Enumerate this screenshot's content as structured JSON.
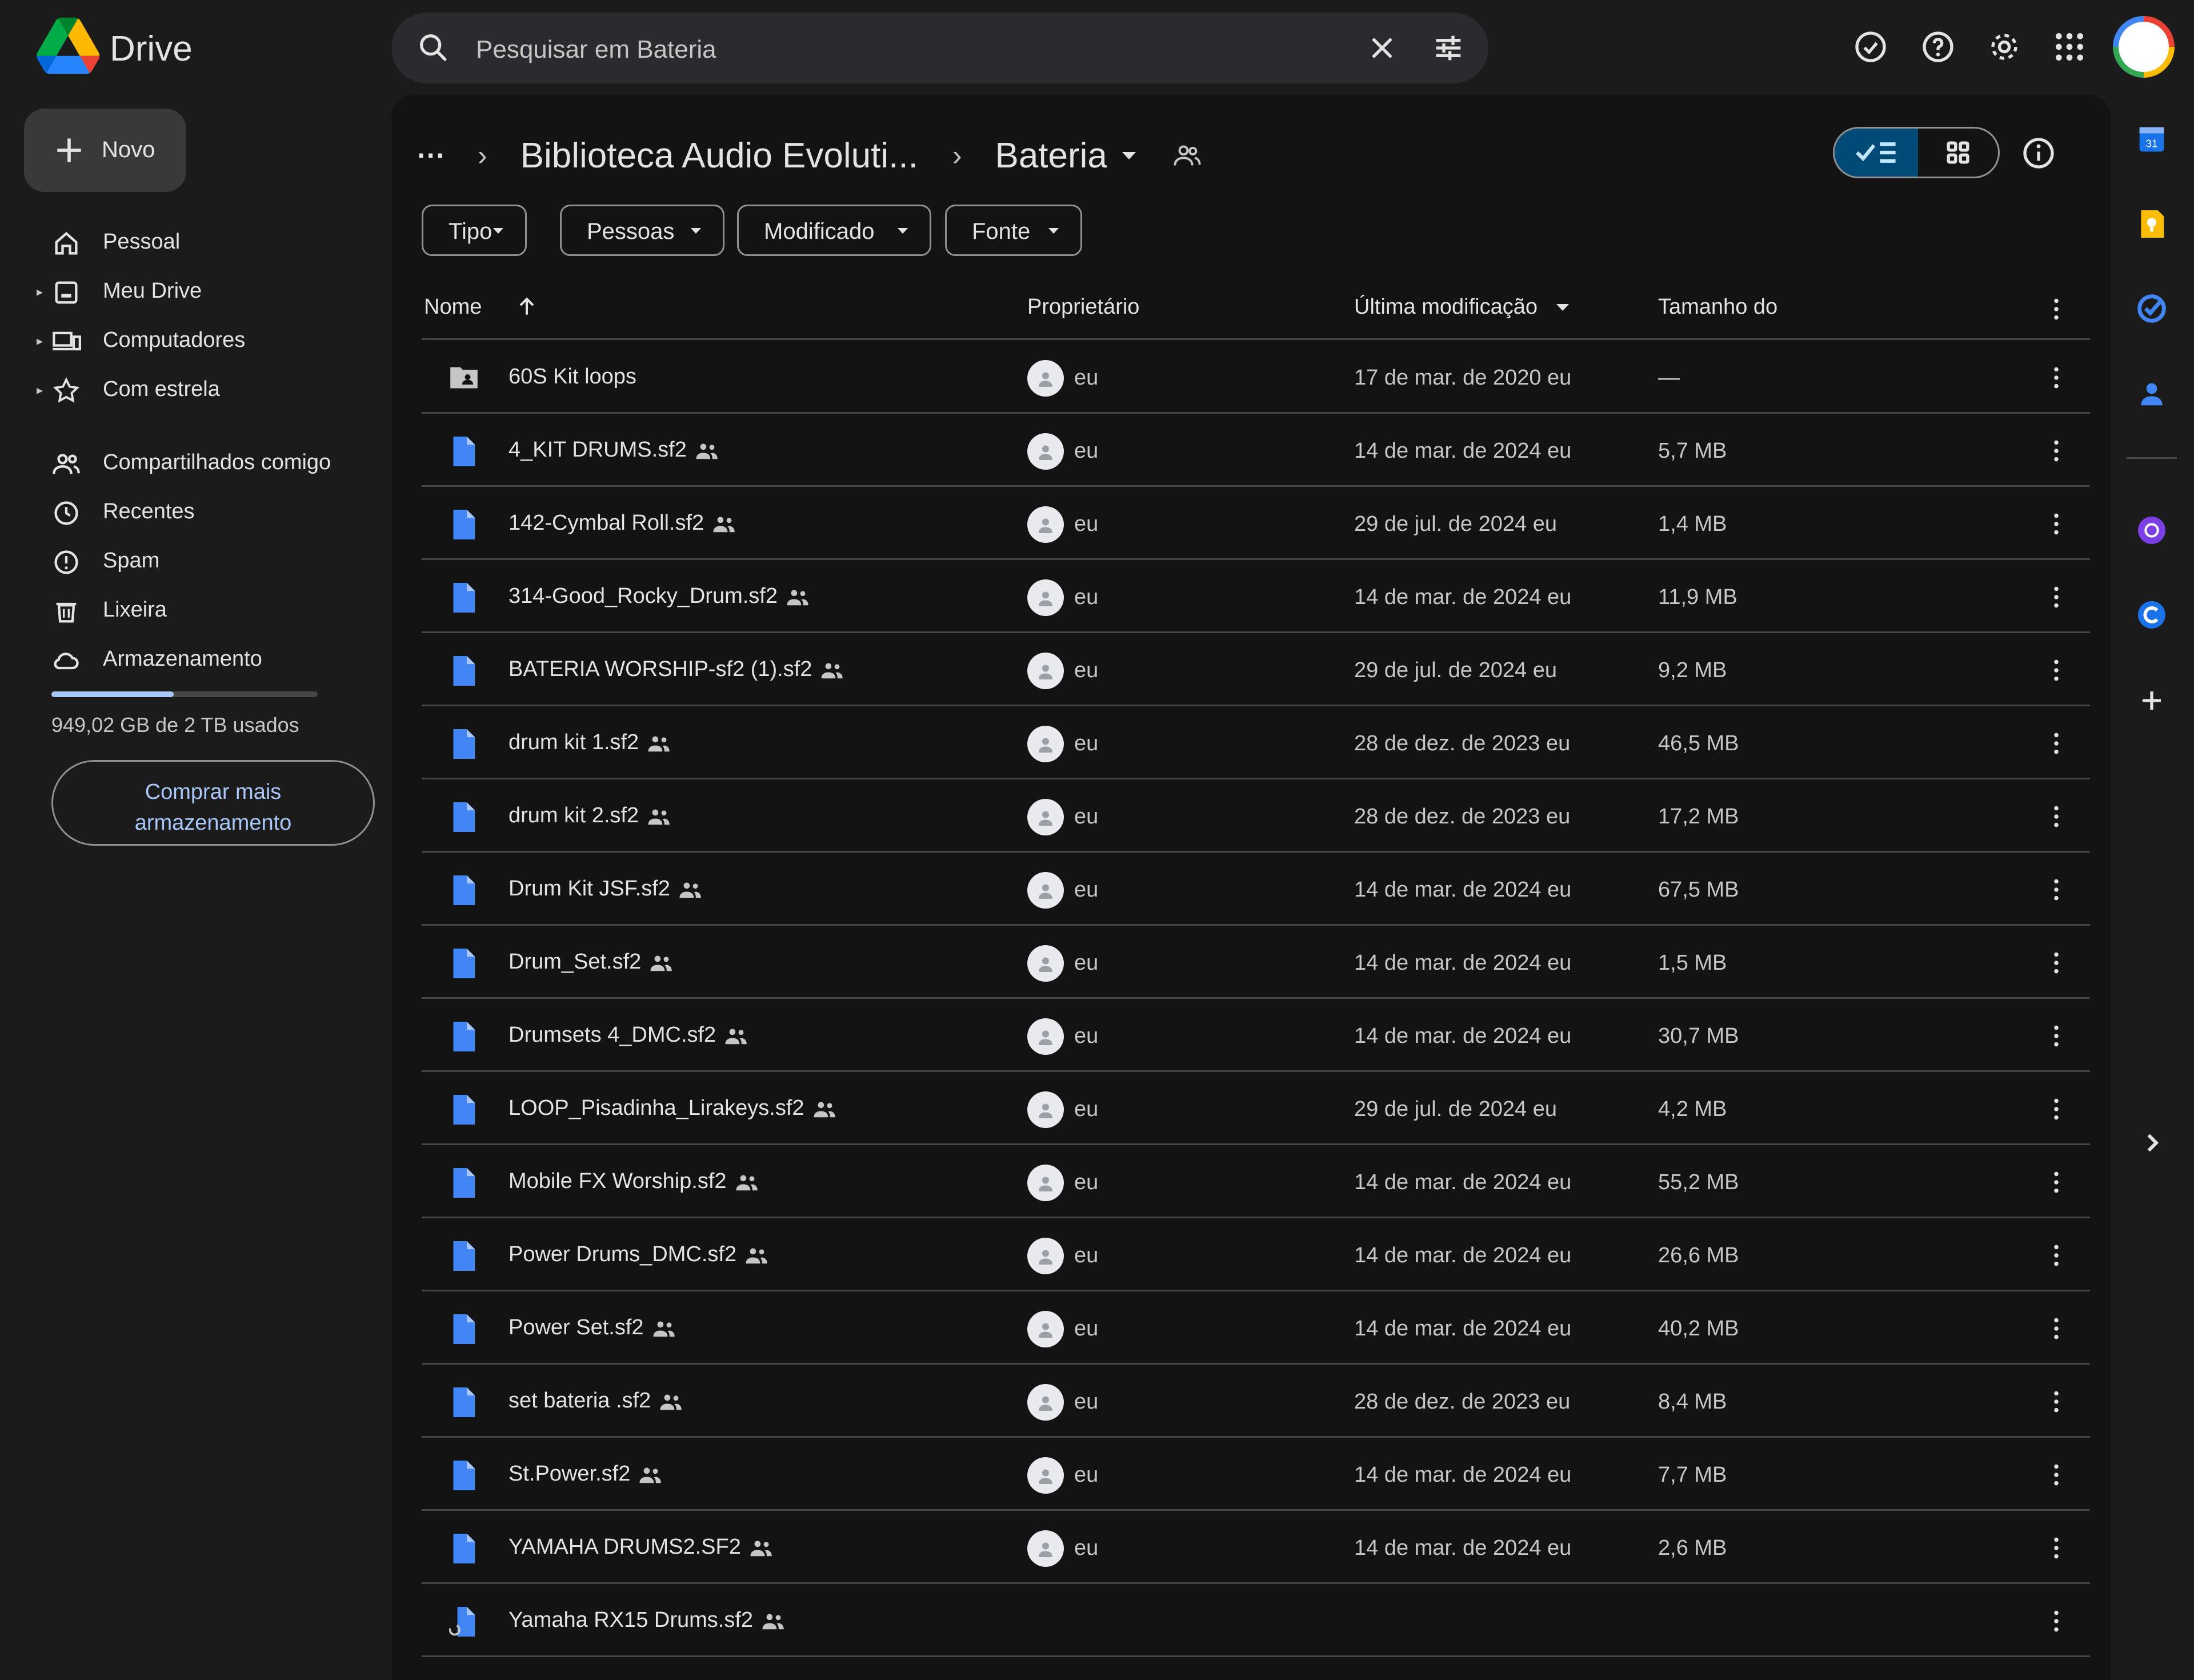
{
  "app": {
    "name": "Drive"
  },
  "search": {
    "text": "Pesquisar em Bateria"
  },
  "sidebar": {
    "new_label": "Novo",
    "items": [
      {
        "label": "Pessoal",
        "icon": "home-icon",
        "expandable": false
      },
      {
        "label": "Meu Drive",
        "icon": "my-drive-icon",
        "expandable": true
      },
      {
        "label": "Computadores",
        "icon": "computers-icon",
        "expandable": true
      },
      {
        "label": "Com estrela",
        "icon": "star-icon",
        "expandable": true
      },
      {
        "label": "Compartilhados comigo",
        "icon": "shared-people-icon",
        "expandable": false
      },
      {
        "label": "Recentes",
        "icon": "clock-icon",
        "expandable": false
      },
      {
        "label": "Spam",
        "icon": "spam-icon",
        "expandable": false
      },
      {
        "label": "Lixeira",
        "icon": "trash-icon",
        "expandable": false
      },
      {
        "label": "Armazenamento",
        "icon": "cloud-icon",
        "expandable": false
      }
    ],
    "storage_text": "949,02 GB de 2 TB usados",
    "storage_fraction": 0.46,
    "buy_storage_label": "Comprar mais armazenamento"
  },
  "breadcrumb": {
    "ellipsis": "···",
    "parent": "Biblioteca Audio Evoluti...",
    "current": "Bateria"
  },
  "filters": [
    {
      "label": "Tipo"
    },
    {
      "label": "Pessoas"
    },
    {
      "label": "Modificado"
    },
    {
      "label": "Fonte"
    }
  ],
  "columns": {
    "name": "Nome",
    "owner": "Proprietário",
    "modified": "Última modificação",
    "size": "Tamanho do"
  },
  "files": [
    {
      "name": "60S Kit loops",
      "type": "folder",
      "shared": false,
      "owner": "eu",
      "modified": "17 de mar. de 2020 eu",
      "size": "—"
    },
    {
      "name": "4_KIT DRUMS.sf2",
      "type": "file",
      "shared": true,
      "owner": "eu",
      "modified": "14 de mar. de 2024 eu",
      "size": "5,7 MB"
    },
    {
      "name": "142-Cymbal Roll.sf2",
      "type": "file",
      "shared": true,
      "owner": "eu",
      "modified": "29 de jul. de 2024 eu",
      "size": "1,4 MB"
    },
    {
      "name": "314-Good_Rocky_Drum.sf2",
      "type": "file",
      "shared": true,
      "owner": "eu",
      "modified": "14 de mar. de 2024 eu",
      "size": "11,9 MB"
    },
    {
      "name": "BATERIA WORSHIP-sf2 (1).sf2",
      "type": "file",
      "shared": true,
      "owner": "eu",
      "modified": "29 de jul. de 2024 eu",
      "size": "9,2 MB"
    },
    {
      "name": "drum kit 1.sf2",
      "type": "file",
      "shared": true,
      "owner": "eu",
      "modified": "28 de dez. de 2023 eu",
      "size": "46,5 MB"
    },
    {
      "name": "drum kit 2.sf2",
      "type": "file",
      "shared": true,
      "owner": "eu",
      "modified": "28 de dez. de 2023 eu",
      "size": "17,2 MB"
    },
    {
      "name": "Drum Kit JSF.sf2",
      "type": "file",
      "shared": true,
      "owner": "eu",
      "modified": "14 de mar. de 2024 eu",
      "size": "67,5 MB"
    },
    {
      "name": "Drum_Set.sf2",
      "type": "file",
      "shared": true,
      "owner": "eu",
      "modified": "14 de mar. de 2024 eu",
      "size": "1,5 MB"
    },
    {
      "name": "Drumsets 4_DMC.sf2",
      "type": "file",
      "shared": true,
      "owner": "eu",
      "modified": "14 de mar. de 2024 eu",
      "size": "30,7 MB"
    },
    {
      "name": "LOOP_Pisadinha_Lirakeys.sf2",
      "type": "file",
      "shared": true,
      "owner": "eu",
      "modified": "29 de jul. de 2024 eu",
      "size": "4,2 MB"
    },
    {
      "name": "Mobile FX Worship.sf2",
      "type": "file",
      "shared": true,
      "owner": "eu",
      "modified": "14 de mar. de 2024 eu",
      "size": "55,2 MB"
    },
    {
      "name": "Power Drums_DMC.sf2",
      "type": "file",
      "shared": true,
      "owner": "eu",
      "modified": "14 de mar. de 2024 eu",
      "size": "26,6 MB"
    },
    {
      "name": "Power Set.sf2",
      "type": "file",
      "shared": true,
      "owner": "eu",
      "modified": "14 de mar. de 2024 eu",
      "size": "40,2 MB"
    },
    {
      "name": "set bateria .sf2",
      "type": "file",
      "shared": true,
      "owner": "eu",
      "modified": "28 de dez. de 2023 eu",
      "size": "8,4 MB"
    },
    {
      "name": "St.Power.sf2",
      "type": "file",
      "shared": true,
      "owner": "eu",
      "modified": "14 de mar. de 2024 eu",
      "size": "7,7 MB"
    },
    {
      "name": "YAMAHA DRUMS2.SF2",
      "type": "file",
      "shared": true,
      "owner": "eu",
      "modified": "14 de mar. de 2024 eu",
      "size": "2,6 MB"
    },
    {
      "name": "Yamaha RX15 Drums.sf2",
      "type": "file-loading",
      "shared": true,
      "owner": "",
      "modified": "",
      "size": ""
    }
  ],
  "colors": {
    "background": "#1b1b1b",
    "panel": "#131314",
    "accent": "#a8c7fa",
    "file_icon": "#4285f4",
    "toggle_active": "#004a77"
  }
}
